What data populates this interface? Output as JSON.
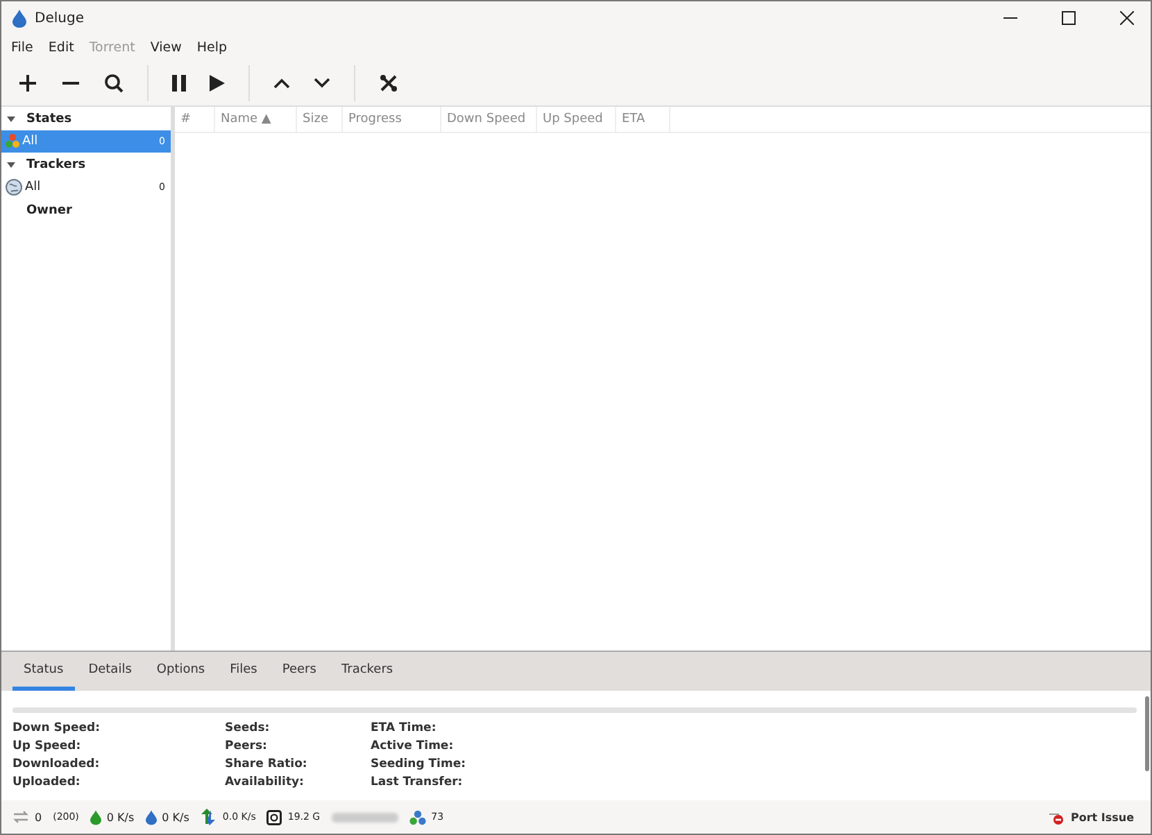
{
  "window": {
    "title": "Deluge"
  },
  "menu": [
    {
      "label": "File",
      "disabled": false
    },
    {
      "label": "Edit",
      "disabled": false
    },
    {
      "label": "Torrent",
      "disabled": true
    },
    {
      "label": "View",
      "disabled": false
    },
    {
      "label": "Help",
      "disabled": false
    }
  ],
  "toolbar": [
    {
      "kind": "add"
    },
    {
      "kind": "remove"
    },
    {
      "kind": "search"
    },
    {
      "kind": "sep"
    },
    {
      "kind": "pause"
    },
    {
      "kind": "play"
    },
    {
      "kind": "sep"
    },
    {
      "kind": "up"
    },
    {
      "kind": "down"
    },
    {
      "kind": "sep"
    },
    {
      "kind": "prefs"
    }
  ],
  "sidebar": {
    "groups": [
      {
        "label": "States",
        "expanded": true,
        "items": [
          {
            "label": "All",
            "count": "0",
            "kind": "states",
            "selected": true
          }
        ]
      },
      {
        "label": "Trackers",
        "expanded": true,
        "items": [
          {
            "label": "All",
            "count": "0",
            "kind": "globe",
            "selected": false
          }
        ]
      },
      {
        "label": "Owner",
        "expanded": false
      }
    ]
  },
  "table": {
    "columns": [
      "#",
      "Name ▲",
      "Size",
      "Progress",
      "Down Speed",
      "Up Speed",
      "ETA"
    ]
  },
  "tabs": [
    {
      "label": "Status",
      "selected": true
    },
    {
      "label": "Details",
      "selected": false
    },
    {
      "label": "Options",
      "selected": false
    },
    {
      "label": "Files",
      "selected": false
    },
    {
      "label": "Peers",
      "selected": false
    },
    {
      "label": "Trackers",
      "selected": false
    }
  ],
  "status_tab": {
    "progress": {
      "level": 0
    },
    "columns": [
      [
        "Down Speed:",
        "Up Speed:",
        "Downloaded:",
        "Uploaded:"
      ],
      [
        "Seeds:",
        "Peers:",
        "Share Ratio:",
        "Availability:"
      ],
      [
        "ETA Time:",
        "Active Time:",
        "Seeding Time:",
        "Last Transfer:"
      ]
    ]
  },
  "status_bar": {
    "connections": "0",
    "connections_limit": "(200)",
    "down": "0 K/s",
    "up": "0 K/s",
    "protocol": "0.0 K/s",
    "disk": "19.2 G",
    "dht": "73",
    "port": "Port Issue"
  }
}
